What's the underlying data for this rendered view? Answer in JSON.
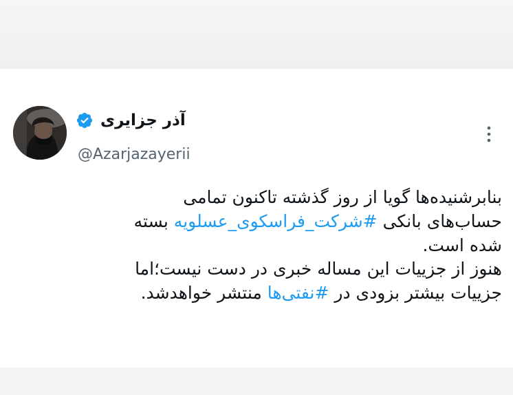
{
  "tweet": {
    "author": {
      "display_name": "آذر جزایری",
      "handle": "@Azarjazayerii",
      "verified": true
    },
    "text_lines": [
      [
        {
          "text": "بنابرشنیده‌ها گویا از روز گذشته تاکنون تمامی"
        }
      ],
      [
        {
          "text": "حساب‌های بانکی "
        },
        {
          "text": "#شرکت_فراسکوی_عسلویه",
          "hashtag": true
        },
        {
          "text": " بسته"
        }
      ],
      [
        {
          "text": "شده است."
        }
      ],
      [
        {
          "text": "هنوز از جزییات این مساله خبری در دست نیست؛اما"
        }
      ],
      [
        {
          "text": "جزییات بیشتر بزودی در "
        },
        {
          "text": "#نفتی‌ها",
          "hashtag": true
        },
        {
          "text": " منتشر خواهدشد."
        }
      ]
    ]
  },
  "icons": {
    "verified": "verified-badge-icon",
    "more": "more-options-icon"
  },
  "colors": {
    "text": "#0f1419",
    "secondary": "#536471",
    "hashtag": "#1d9bf0",
    "verified": "#1d9bf0"
  }
}
